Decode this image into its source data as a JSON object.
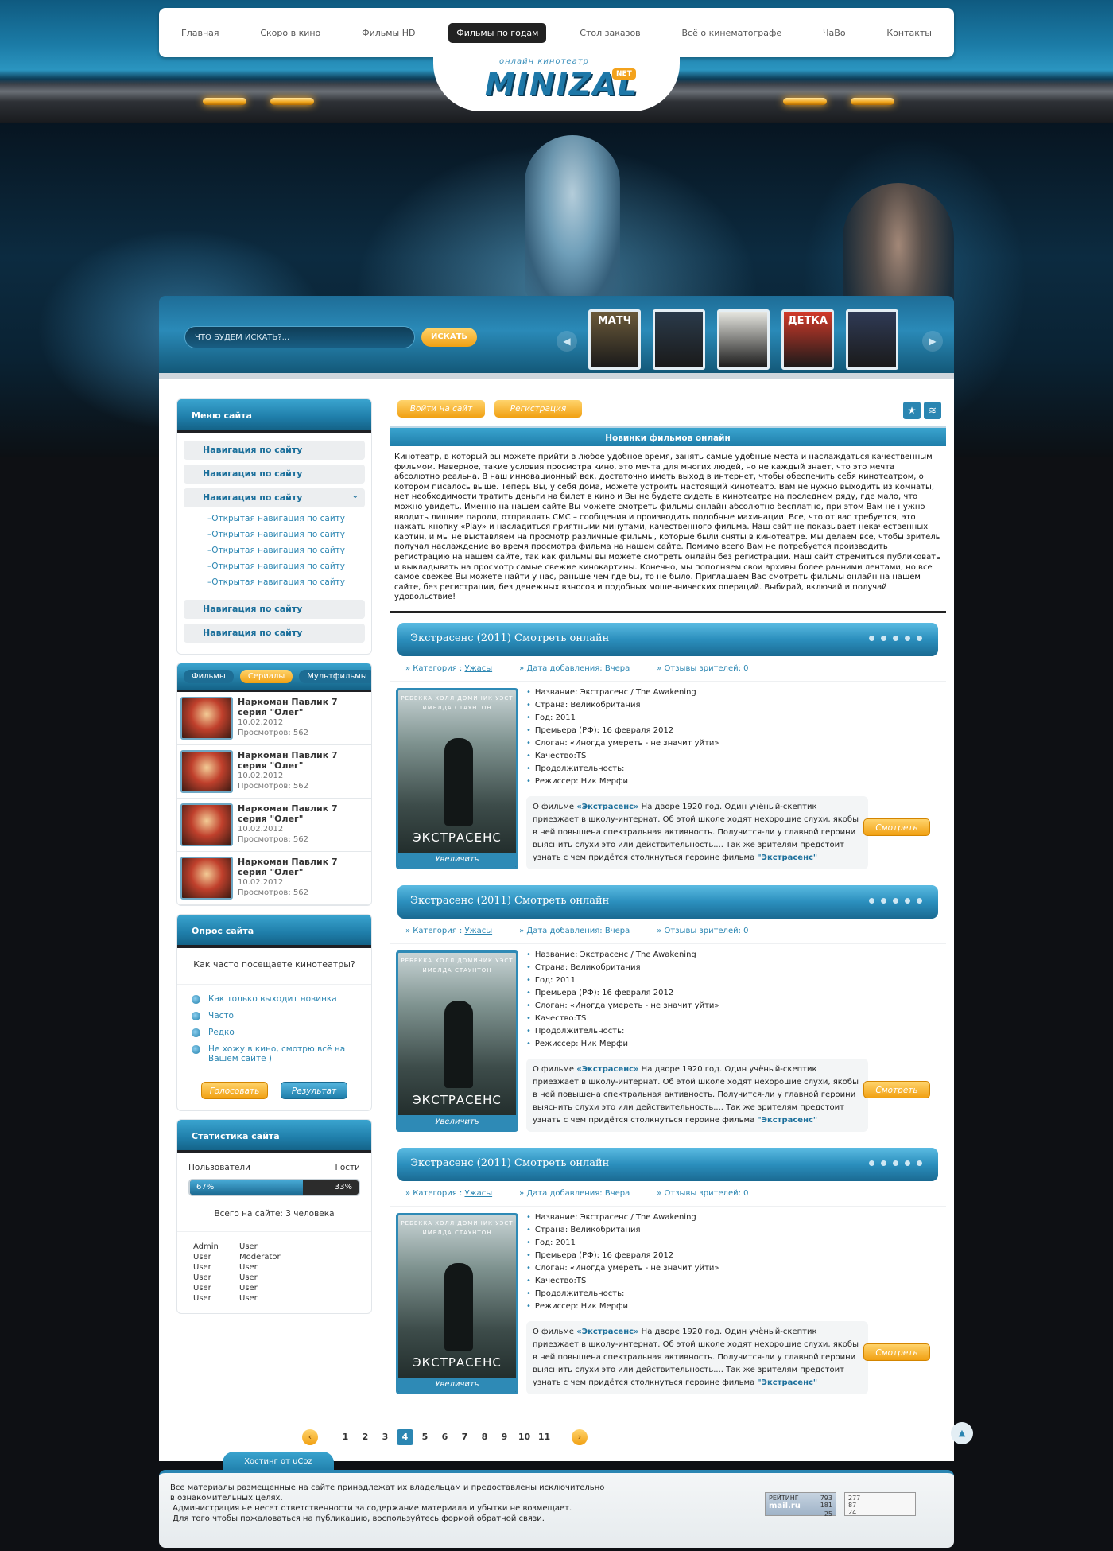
{
  "nav": {
    "items": [
      "Главная",
      "Скоро в кино",
      "Фильмы HD",
      "Фильмы по годам",
      "Стол заказов",
      "Всё о кинематографе",
      "ЧаВо",
      "Контакты"
    ],
    "active_index": 3
  },
  "logo": {
    "sub": "онлайн кинотеатр",
    "main": "MINIZAL",
    "net": "NET"
  },
  "search": {
    "placeholder": "Что будем искать?...",
    "button": "Искать"
  },
  "poster_strip": [
    {
      "label": "МАТЧ",
      "color": "#6b5a3a"
    },
    {
      "label": "",
      "color": "#2a3a4a"
    },
    {
      "label": "",
      "color": "#e6e6e0"
    },
    {
      "label": "ДЕТКА",
      "color": "#d23a2a"
    },
    {
      "label": "",
      "color": "#2f3a55"
    }
  ],
  "menu": {
    "title": "Меню сайта",
    "items_top": [
      "Навигация по сайту",
      "Навигация по сайту",
      "Навигация по сайту"
    ],
    "sub_items": [
      "Открытая навигация по сайту",
      "Открытая навигация по сайту",
      "Открытая навигация по сайту",
      "Открытая навигация по сайту",
      "Открытая навигация по сайту"
    ],
    "items_bottom": [
      "Навигация по сайту",
      "Навигация по сайту"
    ]
  },
  "media_tabs": {
    "tabs": [
      "Фильмы",
      "Сериалы",
      "Мультфильмы"
    ],
    "active_index": 1,
    "items": [
      {
        "title": "Наркоман Павлик 7 серия \"Олег\"",
        "date": "10.02.2012",
        "views": "Просмотров: 562"
      },
      {
        "title": "Наркоман Павлик 7 серия \"Олег\"",
        "date": "10.02.2012",
        "views": "Просмотров: 562"
      },
      {
        "title": "Наркоман Павлик 7 серия \"Олег\"",
        "date": "10.02.2012",
        "views": "Просмотров: 562"
      },
      {
        "title": "Наркоман Павлик 7 серия \"Олег\"",
        "date": "10.02.2012",
        "views": "Просмотров: 562"
      }
    ]
  },
  "poll": {
    "title": "Опрос сайта",
    "question": "Как часто посещаете кинотеатры?",
    "options": [
      "Как только выходит новинка",
      "Часто",
      "Редко",
      "Не хожу в кино, смотрю всё на Вашем сайте )"
    ],
    "vote": "Голосовать",
    "results": "Результат"
  },
  "stats": {
    "title": "Статистика сайта",
    "users_label": "Пользователи",
    "guests_label": "Гости",
    "users_pct": "67%",
    "guests_pct": "33%",
    "users_fraction": 0.67,
    "total": "Всего на сайте: 3 человека",
    "roles": [
      [
        "Admin",
        "User"
      ],
      [
        "User",
        "Moderator"
      ],
      [
        "User",
        "User"
      ],
      [
        "User",
        "User"
      ],
      [
        "User",
        "User"
      ],
      [
        "User",
        "User"
      ]
    ]
  },
  "auth": {
    "login": "Войти на сайт",
    "register": "Регистрация"
  },
  "news": {
    "title": "Новинки фильмов онлайн",
    "intro": "Кинотеатр, в который вы можете прийти в любое удобное время, занять самые удобные места и наслаждаться качественным фильмом. Наверное, такие условия просмотра кино, это мечта для многих людей, но не каждый знает, что это мечта абсолютно реальна. В наш инновационный век, достаточно иметь выход в интернет, чтобы обеспечить себя кинотеатром, о котором писалось выше. Теперь Вы, у себя дома, можете устроить настоящий кинотеатр. Вам не нужно выходить из комнаты, нет необходимости тратить деньги на билет в кино и Вы не будете сидеть в кинотеатре на последнем ряду, где мало, что можно увидеть. Именно на нашем сайте Вы можете смотреть фильмы онлайн абсолютно бесплатно, при этом Вам не нужно вводить лишние пароли, отправлять СМС – сообщения и производить подобные махинации. Все, что от вас требуется, это нажать кнопку «Play» и насладиться приятными минутами, качественного фильма. Наш сайт не показывает некачественных картин, и мы не выставляем на просмотр различные фильмы, которые были сняты в кинотеатре. Мы делаем все, чтобы зритель получал наслаждение во время просмотра фильма на нашем сайте. Помимо всего Вам не потребуется производить регистрацию на нашем сайте, так как фильмы вы можете смотреть онлайн без регистрации. Наш сайт стремиться публиковать и выкладывать на просмотр самые свежие кинокартины. Конечно, мы пополняем свои архивы более ранними лентами, но все самое свежее Вы можете найти у нас, раньше чем где бы, то не было. Приглашаем Вас смотреть фильмы онлайн на нашем сайте, без регистрации, без денежных взносов и подобных мошеннических операций. Выбирай, включай и получай удовольствие!"
  },
  "films": [
    {
      "title": "Экстрасенс (2011) Смотреть онлайн",
      "category_label": "Категория :",
      "category": "Ужасы",
      "date": "Дата добавления: Вчера",
      "reviews": "Отзывы зрителей: 0",
      "specs": [
        "Название: Экстрасенс / The Awakening",
        "Страна: Великобритания",
        "Год: 2011",
        "Премьера (РФ): 16 февраля 2012",
        "Слоган: «Иногда умереть - не значит уйти»",
        "Качество:TS",
        "Продолжительность:",
        "Режиссер: Ник Мерфи"
      ],
      "desc_prefix": "О фильме",
      "desc_name": "«Экстрасенс»",
      "desc_text": "На дворе 1920 год. Один учёный-скептик приезжает в школу-интернат. Об этой школе ходят нехорошие слухи, якобы в ней повышена спектральная активность. Получится-ли у главной героини выяснить слухи это или действительность.... Так же зрителям предстоит узнать с чем придётся столкнуться героине фильма",
      "desc_end": "\"Экстрасенс\"",
      "poster_top": "РЕБЕККА ХОЛЛ   ДОМИНИК УЭСТ",
      "poster_sub": "ИМЕЛДА СТАУНТОН",
      "poster_title": "ЭКСТРАСЕНС",
      "zoom": "Увеличить",
      "watch": "Смотреть"
    },
    {
      "title": "Экстрасенс (2011) Смотреть онлайн",
      "category_label": "Категория :",
      "category": "Ужасы",
      "date": "Дата добавления: Вчера",
      "reviews": "Отзывы зрителей: 0",
      "specs": [
        "Название: Экстрасенс / The Awakening",
        "Страна: Великобритания",
        "Год: 2011",
        "Премьера (РФ): 16 февраля 2012",
        "Слоган: «Иногда умереть - не значит уйти»",
        "Качество:TS",
        "Продолжительность:",
        "Режиссер: Ник Мерфи"
      ],
      "desc_prefix": "О фильме",
      "desc_name": "«Экстрасенс»",
      "desc_text": "На дворе 1920 год. Один учёный-скептик приезжает в школу-интернат. Об этой школе ходят нехорошие слухи, якобы в ней повышена спектральная активность. Получится-ли у главной героини выяснить слухи это или действительность.... Так же зрителям предстоит узнать с чем придётся столкнуться героине фильма",
      "desc_end": "\"Экстрасенс\"",
      "poster_top": "РЕБЕККА ХОЛЛ   ДОМИНИК УЭСТ",
      "poster_sub": "ИМЕЛДА СТАУНТОН",
      "poster_title": "ЭКСТРАСЕНС",
      "zoom": "Увеличить",
      "watch": "Смотреть"
    },
    {
      "title": "Экстрасенс (2011) Смотреть онлайн",
      "category_label": "Категория :",
      "category": "Ужасы",
      "date": "Дата добавления: Вчера",
      "reviews": "Отзывы зрителей: 0",
      "specs": [
        "Название: Экстрасенс / The Awakening",
        "Страна: Великобритания",
        "Год: 2011",
        "Премьера (РФ): 16 февраля 2012",
        "Слоган: «Иногда умереть - не значит уйти»",
        "Качество:TS",
        "Продолжительность:",
        "Режиссер: Ник Мерфи"
      ],
      "desc_prefix": "О фильме",
      "desc_name": "«Экстрасенс»",
      "desc_text": "На дворе 1920 год. Один учёный-скептик приезжает в школу-интернат. Об этой школе ходят нехорошие слухи, якобы в ней повышена спектральная активность. Получится-ли у главной героини выяснить слухи это или действительность.... Так же зрителям предстоит узнать с чем придётся столкнуться героине фильма",
      "desc_end": "\"Экстрасенс\"",
      "poster_top": "РЕБЕККА ХОЛЛ   ДОМИНИК УЭСТ",
      "poster_sub": "ИМЕЛДА СТАУНТОН",
      "poster_title": "ЭКСТРАСЕНС",
      "zoom": "Увеличить",
      "watch": "Смотреть"
    }
  ],
  "pager": {
    "pages": [
      "1",
      "2",
      "3",
      "4",
      "5",
      "6",
      "7",
      "8",
      "9",
      "10",
      "11"
    ],
    "active_index": 3
  },
  "footer": {
    "tab": "Хостинг от uCoz",
    "lines": [
      "Все материалы размещенные на сайте принадлежат их владельцам и предоставлены исключительно",
      "в ознакомительных целях.",
      " Администрация не несет ответственности за содержание материала и убытки не возмещает.",
      " Для того чтобы пожаловаться на публикацию, воспользуйтесь формой обратной связи."
    ],
    "counter_mail_label": "РЕЙТИНГ",
    "counter_mail_brand": "mail.ru",
    "counter_mail_values": [
      "793",
      "181",
      "25"
    ],
    "counter_li_values": [
      "277",
      "87",
      "24"
    ]
  },
  "colors": {
    "accent_blue": "#2b86b2",
    "accent_orange": "#f1a012",
    "dark": "#1f2024"
  }
}
